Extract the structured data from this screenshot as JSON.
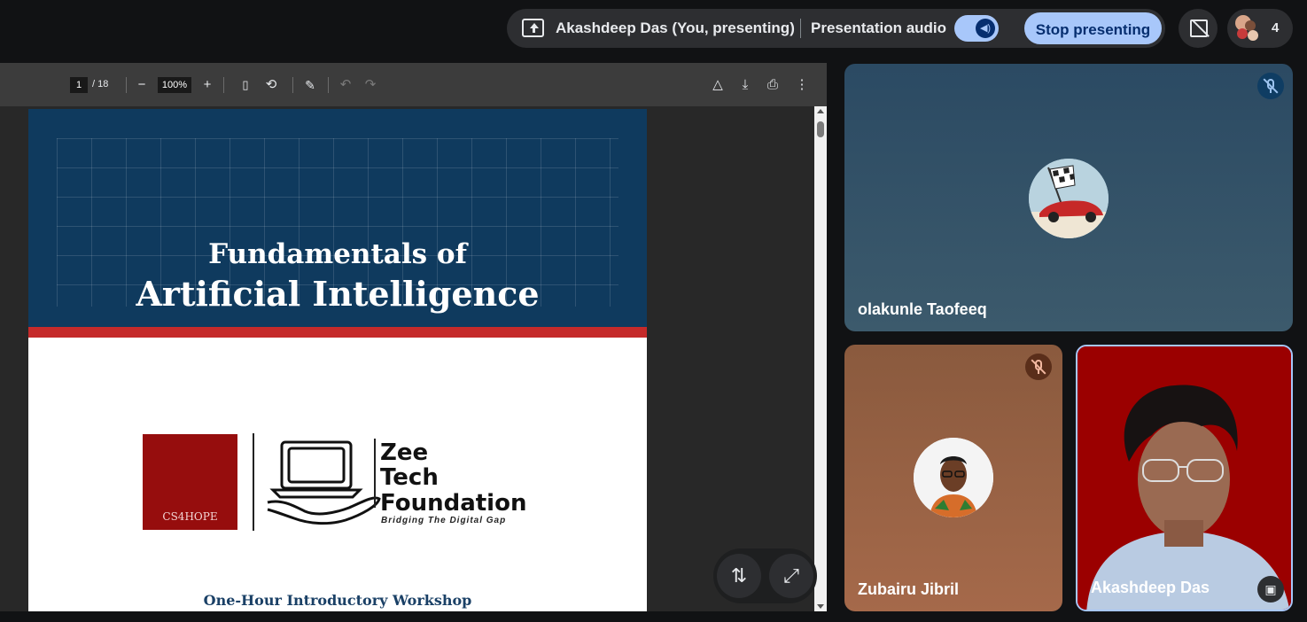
{
  "top_bar": {
    "presenter_label": "Akashdeep Das (You, presenting)",
    "audio_label": "Presentation audio",
    "audio_toggle_on": true,
    "stop_button_label": "Stop presenting",
    "participant_count": "4"
  },
  "pdf_viewer": {
    "current_page": "1",
    "total_pages": "/ 18",
    "zoom": "100%",
    "zoom_out_icon": "minus-icon",
    "zoom_in_icon": "plus-icon"
  },
  "slide": {
    "title_line1": "Fundamentals of",
    "title_line2": "Artificial Intelligence",
    "cs_logo_text": "CS4HOPE",
    "org_line1": "Zee",
    "org_line2": "Tech",
    "org_line3": "Foundation",
    "org_tagline": "Bridging The Digital Gap",
    "workshop": "One-Hour Introductory Workshop"
  },
  "participants": [
    {
      "name": "olakunle Taofeeq",
      "muted": true,
      "tile_color": "#2b4a63"
    },
    {
      "name": "Zubairu Jibril",
      "muted": true,
      "tile_color": "#8a5a3e"
    },
    {
      "name": "Akashdeep Das",
      "muted": false,
      "tile_color": "#9e0000"
    }
  ],
  "colors": {
    "accent": "#a8c7fa",
    "slide_banner": "#0f3a5e",
    "slide_strip": "#c52a2a"
  }
}
